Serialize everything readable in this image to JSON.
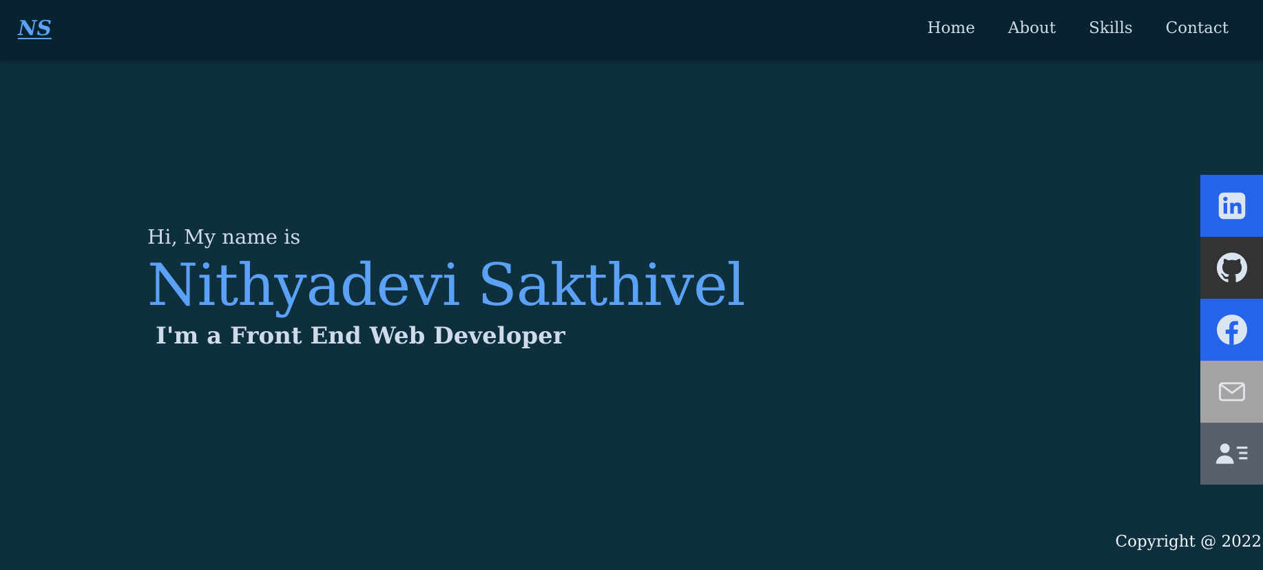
{
  "header": {
    "logo": "NS",
    "nav": [
      {
        "label": "Home"
      },
      {
        "label": "About"
      },
      {
        "label": "Skills"
      },
      {
        "label": "Contact"
      }
    ]
  },
  "hero": {
    "greeting": "Hi, My name is",
    "name": "Nithyadevi Sakthivel",
    "role": "I'm a Front End Web Developer"
  },
  "social": [
    {
      "icon": "linkedin-icon",
      "color": "#2563eb"
    },
    {
      "icon": "github-icon",
      "color": "#333333"
    },
    {
      "icon": "facebook-icon",
      "color": "#2563eb"
    },
    {
      "icon": "mail-icon",
      "color": "#a3a3a3"
    },
    {
      "icon": "contact-card-icon",
      "color": "#595f6c"
    }
  ],
  "footer": {
    "copyright": "Copyright @ 2022"
  },
  "colors": {
    "background": "#0e2f3d",
    "navbar": "#072330",
    "accent": "#5ba1f5",
    "text": "#cfdbe8"
  }
}
